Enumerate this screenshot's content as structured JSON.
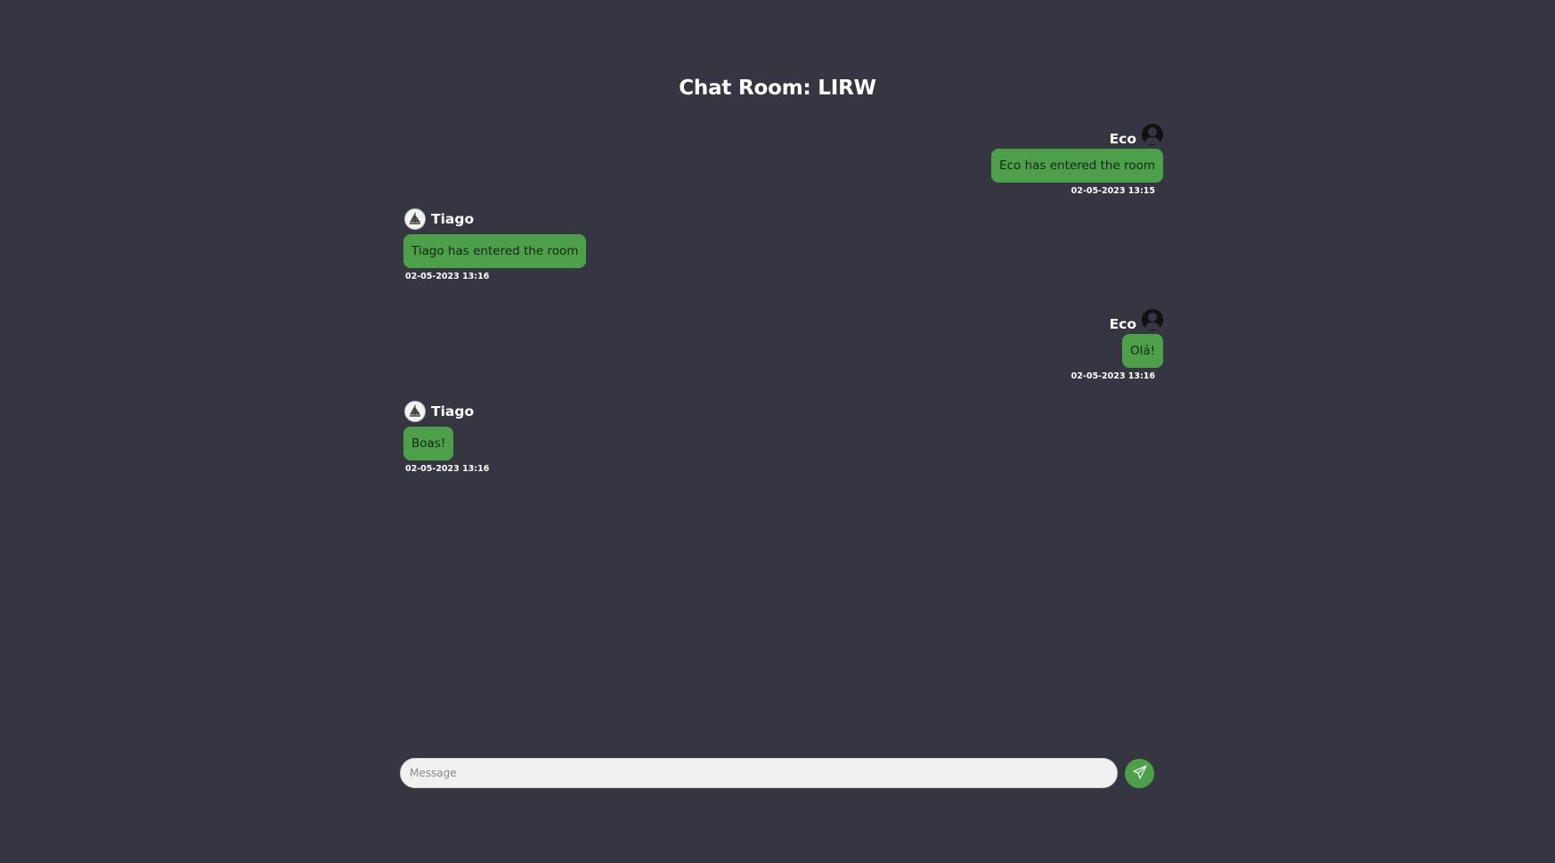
{
  "room": {
    "title": "Chat Room: LIRW"
  },
  "messages": [
    {
      "sender": "Eco",
      "text": "Eco has entered the room",
      "time": "02-05-2023 13:15",
      "own": true
    },
    {
      "sender": "Tiago",
      "text": "Tiago has entered the room",
      "time": "02-05-2023 13:16",
      "own": false
    },
    {
      "sender": "Eco",
      "text": "Olá!",
      "time": "02-05-2023 13:16",
      "own": true
    },
    {
      "sender": "Tiago",
      "text": "Boas!",
      "time": "02-05-2023 13:16",
      "own": false
    }
  ],
  "composer": {
    "placeholder": "Message",
    "value": "",
    "send_icon": "paper-plane-icon"
  },
  "icons": {
    "eco_avatar": "user-circle-icon",
    "tiago_avatar": "sailboat-icon"
  },
  "colors": {
    "background": "#363643",
    "bubble": "#4d9f4a",
    "bubble_text": "#14251a",
    "input_bg": "#f1f1f1"
  }
}
